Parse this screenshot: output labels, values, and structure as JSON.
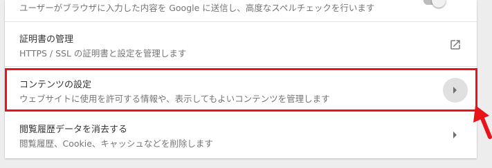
{
  "settings": {
    "spellcheck": {
      "description": "ユーザーがブラウザに入力した内容を Google に送信し、高度なスペルチェックを行います",
      "toggle_on": false
    },
    "certificates": {
      "title": "証明書の管理",
      "description": "HTTPS / SSL の証明書と設定を管理します",
      "icon": "open-in-new-icon"
    },
    "content": {
      "title": "コンテンツの設定",
      "description": "ウェブサイトに使用を許可する情報や、表示してもよいコンテンツを管理します",
      "icon": "arrow-right-icon",
      "highlighted": true
    },
    "clear_data": {
      "title": "閲覧履歴データを消去する",
      "description": "閲覧履歴、Cookie、キャッシュなどを削除します",
      "icon": "arrow-right-icon"
    }
  },
  "annotation": {
    "highlight_color": "#e8141a"
  }
}
